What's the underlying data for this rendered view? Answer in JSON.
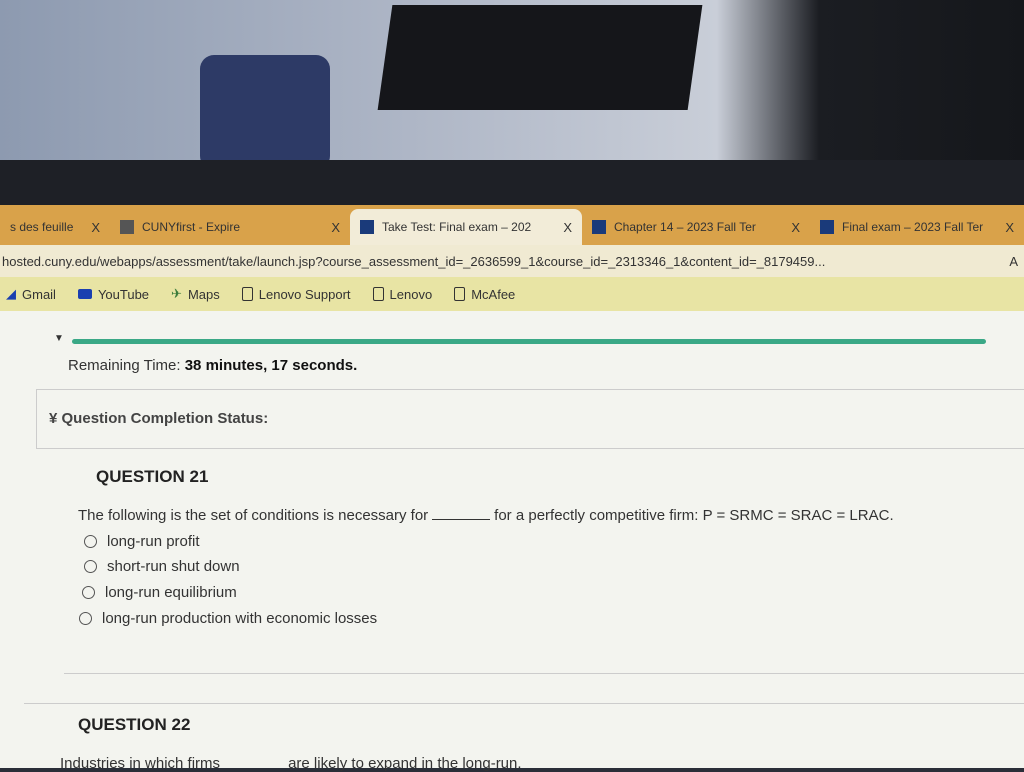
{
  "browser": {
    "tabs": [
      {
        "label": "s des feuille",
        "close": "X"
      },
      {
        "label": "CUNYfirst - Expire",
        "close": "X"
      },
      {
        "label": "Take Test: Final exam – 202",
        "close": "X",
        "active": true
      },
      {
        "label": "Chapter 14 – 2023 Fall Ter",
        "close": "X"
      },
      {
        "label": "Final exam – 2023 Fall Ter",
        "close": "X"
      }
    ],
    "url": "hosted.cuny.edu/webapps/assessment/take/launch.jsp?course_assessment_id=_2636599_1&course_id=_2313346_1&content_id=_8179459...",
    "reader_icon": "A",
    "bookmarks": [
      {
        "label": "Gmail",
        "icon": "gmail-icon"
      },
      {
        "label": "YouTube",
        "icon": "youtube-icon"
      },
      {
        "label": "Maps",
        "icon": "maps-icon"
      },
      {
        "label": "Lenovo Support",
        "icon": "page-icon"
      },
      {
        "label": "Lenovo",
        "icon": "page-icon"
      },
      {
        "label": "McAfee",
        "icon": "page-icon"
      }
    ]
  },
  "test": {
    "progress_color": "#3aa886",
    "timer_label": "Remaining Time:",
    "timer_value": "38 minutes, 17 seconds.",
    "completion_status": "Question Completion Status:",
    "q21": {
      "title": "QUESTION 21",
      "text_before": "The following is the set of conditions is necessary for",
      "text_after": "for a perfectly competitive firm: P = SRMC = SRAC = LRAC.",
      "options": [
        "long-run profit",
        "short-run shut down",
        "long-run equilibrium",
        "long-run production with economic losses"
      ]
    },
    "q22": {
      "title": "QUESTION 22",
      "text_before": "Industries in which firms",
      "text_after": "are likely to expand in the long-run."
    }
  }
}
